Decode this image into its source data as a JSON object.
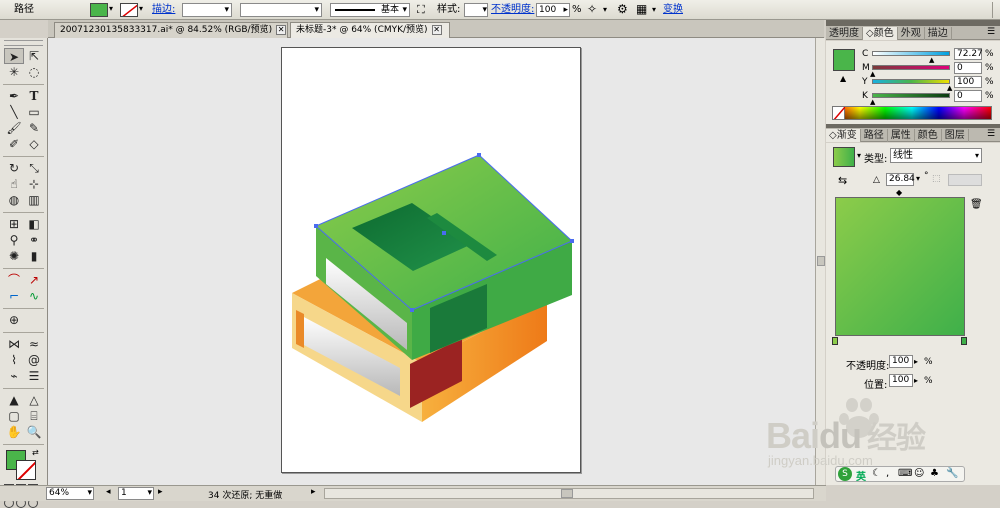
{
  "control_bar": {
    "object_type": "路径",
    "fill_color": "#4ab54a",
    "stroke_label": "描边:",
    "stroke_weight": "",
    "brush_value": "",
    "brush_name": "基本",
    "style_label": "样式:",
    "opacity_label": "不透明度:",
    "opacity_value": "100",
    "percent": "%",
    "transform_label": "变换"
  },
  "doc_tabs": [
    {
      "label": "20071230135833317.ai* @ 84.52% (RGB/预览)",
      "active": false
    },
    {
      "label": "未标题-3* @ 64% (CMYK/预览)",
      "active": true
    }
  ],
  "tools": {
    "icons": [
      "selection-arrow-icon",
      "direct-select-icon",
      "magic-wand-icon",
      "lasso-icon",
      "pen-icon",
      "type-icon",
      "line-icon",
      "rectangle-icon",
      "paintbrush-icon",
      "pencil-icon",
      "blob-brush-icon",
      "eraser-icon",
      "rotate-icon",
      "scale-icon",
      "warp-icon",
      "free-transform-icon",
      "shape-builder-icon",
      "perspective-icon",
      "mesh-icon",
      "gradient-icon",
      "eyedropper-icon",
      "blend-icon",
      "symbol-sprayer-icon",
      "graph-icon",
      "artboard-icon",
      "slice-icon",
      "hand-icon",
      "zoom-icon"
    ],
    "fill_color": "#4ab54a"
  },
  "color_panel": {
    "tabs": [
      "透明度",
      "颜色",
      "外观",
      "描边"
    ],
    "active_tab": "颜色",
    "swatch": "#4ab54a",
    "channels": [
      {
        "name": "C",
        "value": "72.27",
        "fraction": 0.72,
        "color": "#00a0e0"
      },
      {
        "name": "M",
        "value": "0",
        "fraction": 0.0,
        "color": "#e0007a"
      },
      {
        "name": "Y",
        "value": "100",
        "fraction": 1.0,
        "color": "#f0e000"
      },
      {
        "name": "K",
        "value": "0",
        "fraction": 0.0,
        "color": "#222222"
      }
    ],
    "percent": "%"
  },
  "gradient_panel": {
    "tabs": [
      "渐变",
      "路径",
      "属性",
      "颜色",
      "图层"
    ],
    "active_tab": "渐变",
    "type_label": "类型:",
    "type_value": "线性",
    "angle_value": "26.84",
    "degree": "°",
    "start_color": "#8ccc4a",
    "end_color": "#3fb04a",
    "opacity_label": "不透明度:",
    "opacity_value": "100",
    "location_label": "位置:",
    "location_value": "100",
    "percent": "%"
  },
  "status_bar": {
    "zoom": "64%",
    "page": "1",
    "status_text": "34 次还原; 无重做"
  },
  "watermark": {
    "brand_latin": "Bai",
    "brand_du": "du",
    "brand_cn": "经验",
    "url": "jingyan.baidu.com"
  },
  "tray": {
    "ime_label": "英"
  }
}
